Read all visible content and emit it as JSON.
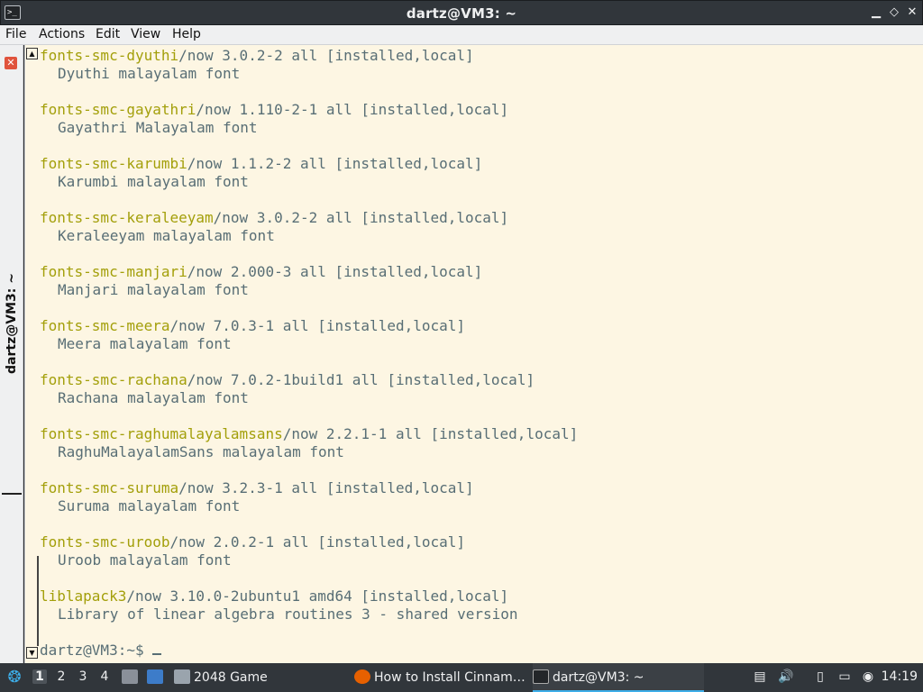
{
  "window": {
    "title": "dartz@VM3: ~",
    "app_icon": ">_",
    "controls": {
      "minimize": "▁",
      "maximize": "◇",
      "close": "✕"
    }
  },
  "menu": [
    "File",
    "Actions",
    "Edit",
    "View",
    "Help"
  ],
  "side_tab": {
    "label": "dartz@VM3: ~",
    "close_icon": "✕"
  },
  "terminal": {
    "entries": [
      {
        "name": "fonts-smc-dyuthi",
        "rest": "/now 3.0.2-2 all [installed,local]",
        "desc": "Dyuthi malayalam font"
      },
      {
        "name": "fonts-smc-gayathri",
        "rest": "/now 1.110-2-1 all [installed,local]",
        "desc": "Gayathri Malayalam font"
      },
      {
        "name": "fonts-smc-karumbi",
        "rest": "/now 1.1.2-2 all [installed,local]",
        "desc": "Karumbi malayalam font"
      },
      {
        "name": "fonts-smc-keraleeyam",
        "rest": "/now 3.0.2-2 all [installed,local]",
        "desc": "Keraleeyam malayalam font"
      },
      {
        "name": "fonts-smc-manjari",
        "rest": "/now 2.000-3 all [installed,local]",
        "desc": "Manjari malayalam font"
      },
      {
        "name": "fonts-smc-meera",
        "rest": "/now 7.0.3-1 all [installed,local]",
        "desc": "Meera malayalam font"
      },
      {
        "name": "fonts-smc-rachana",
        "rest": "/now 7.0.2-1build1 all [installed,local]",
        "desc": "Rachana malayalam font"
      },
      {
        "name": "fonts-smc-raghumalayalamsans",
        "rest": "/now 2.2.1-1 all [installed,local]",
        "desc": "RaghuMalayalamSans malayalam font"
      },
      {
        "name": "fonts-smc-suruma",
        "rest": "/now 3.2.3-1 all [installed,local]",
        "desc": "Suruma malayalam font"
      },
      {
        "name": "fonts-smc-uroob",
        "rest": "/now 2.0.2-1 all [installed,local]",
        "desc": "Uroob malayalam font"
      },
      {
        "name": "liblapack3",
        "rest": "/now 3.10.0-2ubuntu1 amd64 [installed,local]",
        "desc": "Library of linear algebra routines 3 - shared version"
      }
    ],
    "prompt": "dartz@VM3:~$ ",
    "colors": {
      "background": "#fdf6e3",
      "text": "#586e75",
      "package_name": "#a39f0a"
    }
  },
  "taskbar": {
    "desktops": [
      "1",
      "2",
      "3",
      "4"
    ],
    "tasks": [
      {
        "label": "2048 Game",
        "icon": "window-icon"
      },
      {
        "label": "How to Install Cinnam…",
        "icon": "firefox-icon"
      },
      {
        "label": "dartz@VM3: ~",
        "icon": "terminal-icon"
      }
    ],
    "clock": "14:19",
    "accent": "#3daee9"
  }
}
